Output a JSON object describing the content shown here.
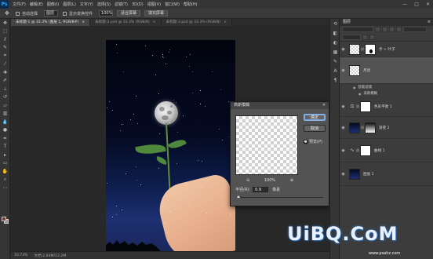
{
  "menubar": {
    "items": [
      "文件(F)",
      "编辑(E)",
      "图像(I)",
      "图层(L)",
      "文字(Y)",
      "选择(S)",
      "滤镜(T)",
      "3D(D)",
      "视图(V)",
      "窗口(W)",
      "帮助(H)"
    ],
    "window_controls": [
      "—",
      "□",
      "✕"
    ]
  },
  "optbar": {
    "checkbox_label": "自动选择",
    "target_value": "图层",
    "show_transform_label": "显示变换控件",
    "zoom_value": "100%",
    "fit_screen_label": "适合屏幕",
    "fill_screen_label": "填充屏幕"
  },
  "tabs": [
    {
      "label": "未标题-1 @ 33.3% (图层 1, RGB/8#)",
      "active": true
    },
    {
      "label": "未标题-2.psd @ 33.3% (RGB/8)",
      "active": false
    },
    {
      "label": "未标题-3.psd @ 33.3% (RGB/8)",
      "active": false
    }
  ],
  "dialog": {
    "title": "高斯模糊",
    "ok_label": "确定",
    "cancel_label": "取消",
    "preview_label": "预览(P)",
    "zoom_out": "⊖",
    "zoom_in": "⊕",
    "zoom_value": "100%",
    "radius_label": "半径(R):",
    "radius_value": "0.9",
    "radius_unit": "像素",
    "close": "✕"
  },
  "statusbar": {
    "zoom": "33.73%",
    "doc_info": "文档:2.64M/13.2M"
  },
  "layers_panel": {
    "title": "图层",
    "menu": "≡",
    "layers": [
      {
        "name": "手 + 叶子",
        "selected": false,
        "thumb": "checker",
        "mask": "blob"
      },
      {
        "name": "月亮",
        "selected": true,
        "thumb": "checker",
        "mask": "none"
      },
      {
        "sub": [
          "智能滤镜",
          "高斯模糊"
        ]
      },
      {
        "name": "色彩平衡 1",
        "selected": false,
        "thumb": "adjust",
        "mask": "white"
      },
      {
        "name": "渐变 2",
        "selected": false,
        "thumb": "navy",
        "mask": "gradient"
      },
      {
        "name": "曲线 1",
        "selected": false,
        "thumb": "adjust",
        "mask": "white"
      },
      {
        "name": "图层 1",
        "selected": false,
        "thumb": "navy",
        "mask": "none"
      }
    ]
  },
  "watermark": {
    "text": "UiBQ.CoM",
    "sub": "www.psahz.com"
  },
  "colors": {
    "foreground": "#7a3f2e",
    "background": "#9a9a9a",
    "accent": "#31a8ff"
  }
}
